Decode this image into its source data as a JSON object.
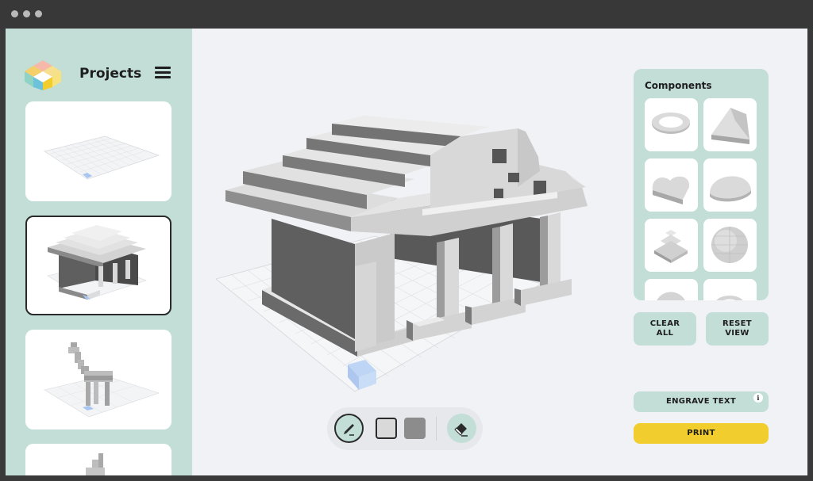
{
  "window": {
    "dots": [
      "close-dot",
      "minimize-dot",
      "maximize-dot"
    ]
  },
  "sidebar": {
    "title": "Projects",
    "menu_icon": "hamburger-menu-icon",
    "logo_icon": "voxel-cube-logo",
    "projects": [
      {
        "name": "empty-grid-project",
        "selected": false
      },
      {
        "name": "temple-project",
        "selected": true
      },
      {
        "name": "giraffe-project",
        "selected": false
      },
      {
        "name": "partial-project",
        "selected": false
      }
    ]
  },
  "toolbar": {
    "tools": [
      "pencil-tool",
      "outline-block-tool",
      "solid-block-tool",
      "eraser-tool"
    ],
    "active_tool": "pencil-tool"
  },
  "components": {
    "title": "Components",
    "items": [
      "ring",
      "wedge",
      "heart",
      "dome",
      "pyramid",
      "sphere",
      "cone",
      "arch"
    ]
  },
  "actions": {
    "clear_all": "CLEAR\nALL",
    "clear_all_line1": "CLEAR",
    "clear_all_line2": "ALL",
    "reset_view_line1": "RESET",
    "reset_view_line2": "VIEW",
    "engrave_text": "ENGRAVE TEXT",
    "info": "i",
    "print": "PRINT"
  },
  "colors": {
    "accent_teal": "#c2ded6",
    "print_yellow": "#f2cd2e",
    "voxel_light": "#d3d3d3",
    "voxel_dark": "#5f5f5f"
  }
}
